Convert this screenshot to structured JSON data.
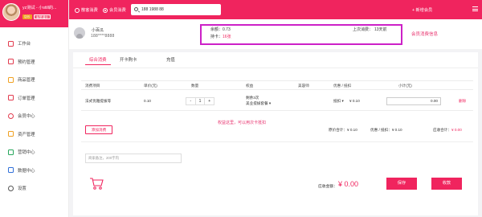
{
  "sidebar": {
    "user_name": "yz测试 - 小still的...",
    "tags": [
      "店长",
      "有赞通业"
    ],
    "items": [
      {
        "label": "工作台",
        "icon": "monitor-icon",
        "color": "#e23b4e"
      },
      {
        "label": "预约管理",
        "icon": "calendar-icon",
        "color": "#e23b4e"
      },
      {
        "label": "商品管理",
        "icon": "box-icon",
        "color": "#f0a020"
      },
      {
        "label": "订单管理",
        "icon": "order-icon",
        "color": "#e23b4e"
      },
      {
        "label": "会员中心",
        "icon": "user-icon",
        "color": "#e23b4e"
      },
      {
        "label": "资产管理",
        "icon": "wallet-icon",
        "color": "#f0a020"
      },
      {
        "label": "营销中心",
        "icon": "gift-icon",
        "color": "#26a65b"
      },
      {
        "label": "数据中心",
        "icon": "chart-icon",
        "color": "#2f6fd8"
      },
      {
        "label": "设置",
        "icon": "gear-icon",
        "color": "#555555"
      }
    ]
  },
  "topbar": {
    "mode_scan": "散客消费",
    "mode_member": "会员消费",
    "search_value": "188 1988 88",
    "new_member": "+ 新增会员"
  },
  "member": {
    "name": "小百瓜",
    "phone": "188****8888",
    "balance_label": "余额：",
    "balance_value": "0.73",
    "cards_label": "持卡：",
    "cards_value": "16张",
    "last_consume_label": "上次消费：",
    "last_consume_value": "13天前",
    "info_note": "会员消费信息"
  },
  "tabs": [
    "综合消费",
    "开卡购卡",
    "充值"
  ],
  "table": {
    "headers": [
      "消费项目",
      "单价(元)",
      "数量",
      "权益",
      "美容师",
      "优惠 / 抵扣",
      "小计(元)"
    ],
    "row": {
      "item": "法式优雅提拔等",
      "unit_price": "0.10",
      "qty_minus": "-",
      "qty": "1",
      "qty_plus": "+",
      "rights_main": "剩余3次",
      "rights_sub": "美业提拔套餐",
      "deduct_label": "抵扣",
      "deduct_value": "¥ 0.10",
      "subtotal": "0.00",
      "delete": "删除"
    }
  },
  "add_consume": "添加消费",
  "rights_note": "权益这里，可以用次卡抵扣",
  "totals": {
    "original_label": "原价合计：",
    "original_value": "¥ 0.10",
    "discount_label": "优惠 / 抵扣：",
    "discount_value": "¥ 0.10",
    "payable_label": "应收合计：",
    "payable_value": "¥ 0.00"
  },
  "remark_placeholder": "商家备注，200字内",
  "pay": {
    "label": "应收金额：",
    "value": "¥ 0.00",
    "save": "保存",
    "checkout": "收款"
  }
}
